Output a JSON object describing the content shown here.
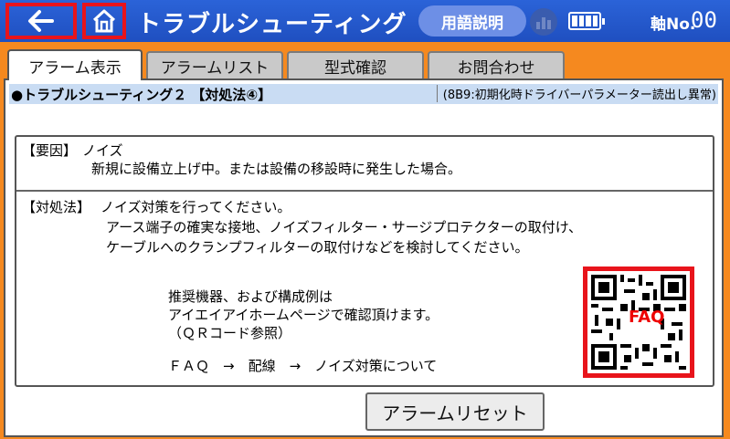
{
  "header": {
    "title": "トラブルシューティング",
    "glossary_label": "用語説明",
    "axis_label": "軸No.",
    "axis_value": "00",
    "brand_color": "#1f4fc0",
    "alert_color": "#e8141b"
  },
  "tabs": [
    {
      "label": "アラーム表示",
      "active": true
    },
    {
      "label": "アラームリスト",
      "active": false
    },
    {
      "label": "型式確認",
      "active": false
    },
    {
      "label": "お問合わせ",
      "active": false
    }
  ],
  "section": {
    "title": "●トラブルシューティング２ 【対処法④】",
    "code": "(8B9:初期化時ドライバーパラメーター読出し異常)"
  },
  "cause": {
    "label": "【要因】",
    "heading": "ノイズ",
    "detail": "新規に設備立上げ中。または設備の移設時に発生した場合。"
  },
  "remedy": {
    "label": "【対処法】",
    "heading": "ノイズ対策を行ってください。",
    "lines": [
      "アース端子の確実な接地、ノイズフィルター・サージプロテクターの取付け、",
      "ケーブルへのクランプフィルターの取付けなどを検討してください。"
    ],
    "note_lines": [
      "推奨機器、および構成例は",
      "アイエイアイホームページで確認頂けます。",
      "（ＱＲコード参照）"
    ],
    "path": "ＦＡＱ　→　配線　→　ノイズ対策について"
  },
  "qr": {
    "overlay_text": "FAQ",
    "icon": "qr-code-icon"
  },
  "reset_button": "アラームリセット",
  "icons": [
    "back-arrow-icon",
    "home-icon",
    "monitor-chart-icon",
    "battery-icon"
  ]
}
